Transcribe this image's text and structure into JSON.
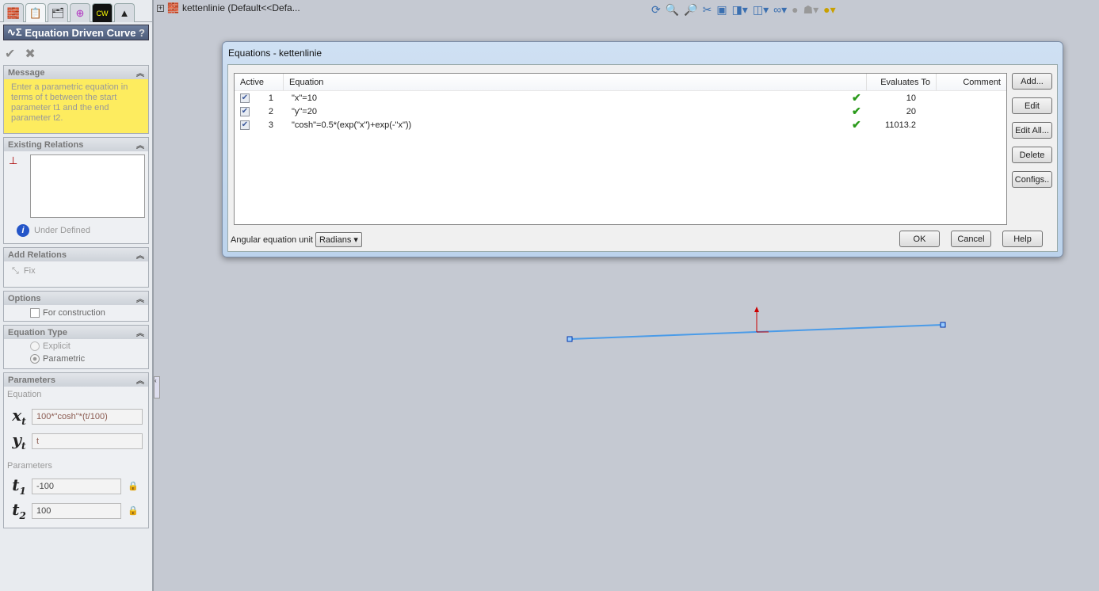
{
  "tree": {
    "label": "kettenlinie  (Default<<Defa..."
  },
  "pm": {
    "title": "Equation Driven Curve",
    "help": "?",
    "message_title": "Message",
    "message": "Enter a parametric equation in terms of t between the start parameter t1 and the end parameter t2.",
    "relations_title": "Existing Relations",
    "status": "Under Defined",
    "add_relations_title": "Add Relations",
    "fix": "Fix",
    "options_title": "Options",
    "for_construction": "For construction",
    "eqtype_title": "Equation Type",
    "explicit": "Explicit",
    "parametric": "Parametric",
    "params_title": "Parameters",
    "equation_label": "Equation",
    "parameters_label": "Parameters",
    "xt": "100*\"cosh\"*(t/100)",
    "yt": "t",
    "t1": "-100",
    "t2": "100"
  },
  "dialog": {
    "title": "Equations - kettenlinie",
    "headers": {
      "active": "Active",
      "equation": "Equation",
      "evaluates": "Evaluates To",
      "comment": "Comment"
    },
    "rows": [
      {
        "n": "1",
        "eq": "\"x\"=10",
        "val": "10"
      },
      {
        "n": "2",
        "eq": "\"y\"=20",
        "val": "20"
      },
      {
        "n": "3",
        "eq": "\"cosh\"=0.5*(exp(\"x\")+exp(-\"x\"))",
        "val": "11013.2"
      }
    ],
    "buttons": {
      "add": "Add...",
      "edit": "Edit",
      "edit_all": "Edit All...",
      "delete": "Delete",
      "configs": "Configs..",
      "ok": "OK",
      "cancel": "Cancel",
      "help": "Help"
    },
    "angular_label": "Angular equation unit",
    "angular_value": "Radians"
  }
}
